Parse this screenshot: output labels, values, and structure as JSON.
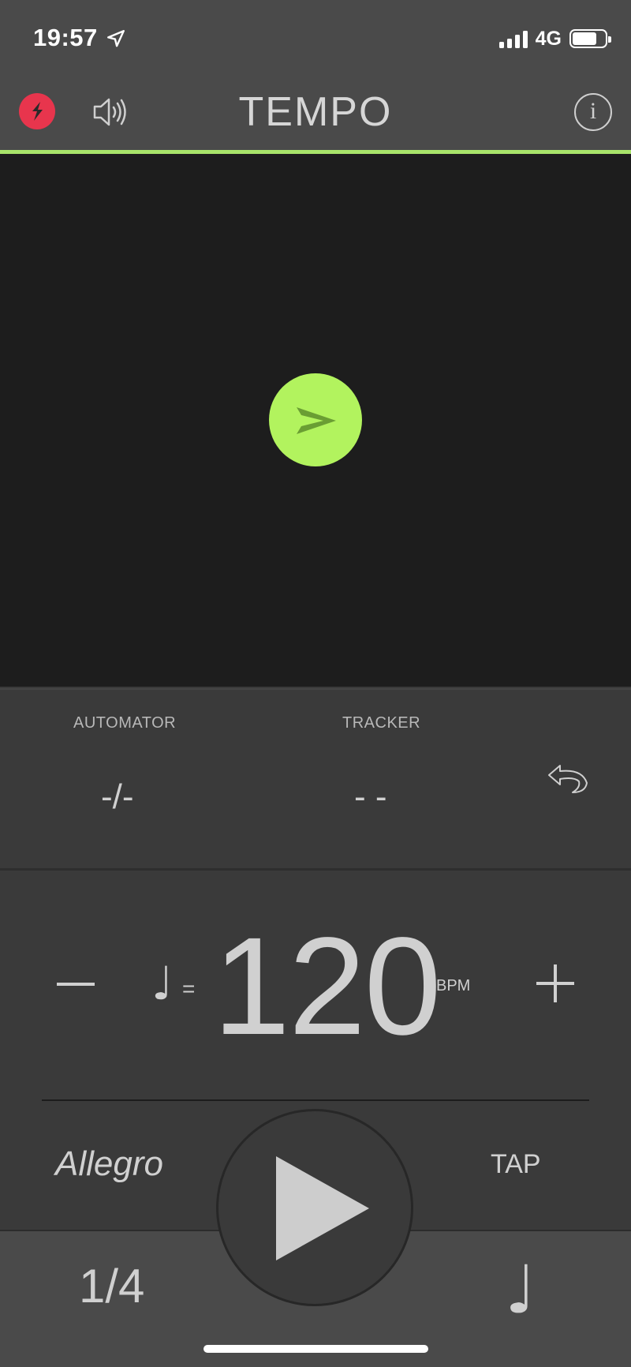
{
  "status_bar": {
    "time": "19:57",
    "network": "4G",
    "icons": [
      "location-arrow-icon",
      "signal-bars-icon",
      "battery-icon"
    ]
  },
  "header": {
    "title": "TEMPO",
    "accent_color": "#a8e46a",
    "logo_color": "#e8354d",
    "icons": [
      "app-logo-icon",
      "speaker-icon",
      "info-icon"
    ],
    "info_glyph": "i"
  },
  "visual": {
    "background": "#1d1d1d",
    "beat_indicator_color": "#b2f35e",
    "beat_indicator_icon": "accent-marker-icon"
  },
  "automator": {
    "label": "AUTOMATOR",
    "value": "-/-"
  },
  "tracker": {
    "label": "TRACKER",
    "value": "- -",
    "reset_icon": "undo-icon"
  },
  "tempo": {
    "decrease_icon": "minus-icon",
    "note_glyph": "♩",
    "equals": "=",
    "bpm": "120",
    "unit": "BPM",
    "increase_icon": "plus-icon",
    "tempo_marking": "Allegro",
    "tap_label": "TAP"
  },
  "bottom": {
    "time_signature": "1/4",
    "play_icon": "play-icon",
    "subdivision_glyph": "♩"
  }
}
